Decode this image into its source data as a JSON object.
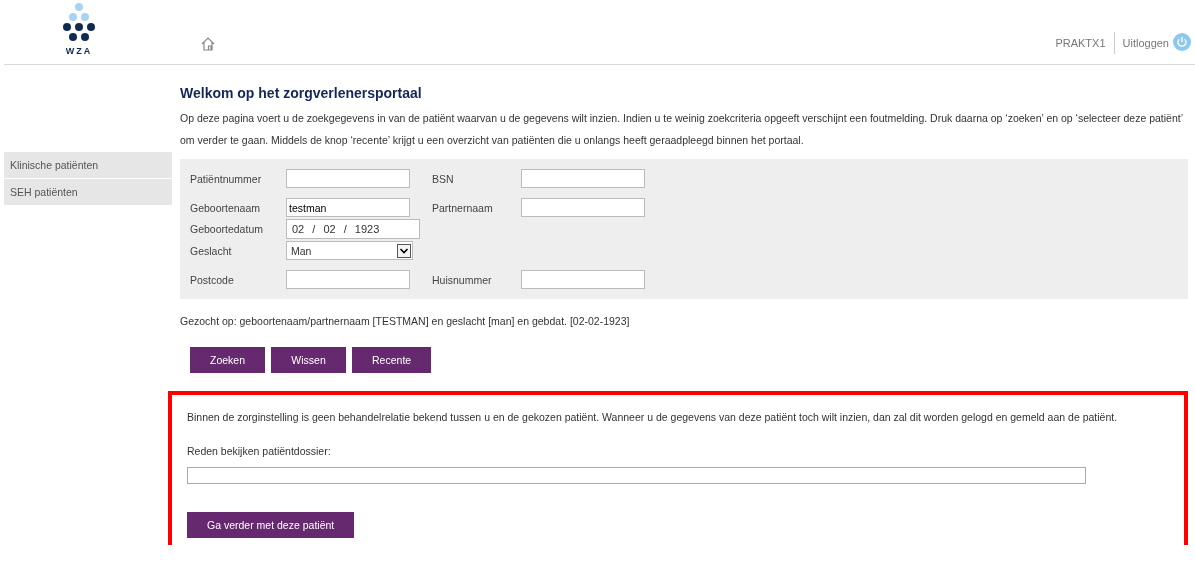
{
  "header": {
    "logo_text": "WZA",
    "user": "PRAKTX1",
    "logout": "Uitloggen"
  },
  "sidebar": {
    "items": [
      {
        "label": "Klinische patiënten",
        "selected": false
      },
      {
        "label": "SEH patiënten",
        "selected": false
      }
    ]
  },
  "title": "Welkom op het zorgverlenersportaal",
  "intro": "Op deze pagina voert u de zoekgegevens in van de patiënt waarvan u de gegevens wilt inzien. Indien u te weinig zoekcriteria opgeeft verschijnt een foutmelding. Druk daarna op ‘zoeken’ en op ‘selecteer deze patiënt’ om verder te gaan. Middels de knop ‘recente’ krijgt u een overzicht van patiënten die u onlangs heeft geraadpleegd binnen het portaal.",
  "form": {
    "groups": [
      {
        "rows": [
          {
            "fields": [
              {
                "label": "Patiëntnummer",
                "kind": "text"
              },
              {
                "label": "BSN",
                "kind": "text"
              }
            ]
          }
        ]
      },
      {
        "rows": [
          {
            "fields": [
              {
                "label": "Geboortenaam",
                "kind": "text",
                "value": "testman"
              },
              {
                "label": "Partnernaam",
                "kind": "text"
              }
            ]
          },
          {
            "fields": [
              {
                "label": "Geboortedatum",
                "kind": "date",
                "value": "02 / 02 / 1923"
              }
            ]
          },
          {
            "fields": [
              {
                "label": "Geslacht",
                "kind": "select",
                "value": "Man"
              }
            ]
          }
        ]
      },
      {
        "rows": [
          {
            "fields": [
              {
                "label": "Postcode",
                "kind": "text"
              },
              {
                "label": "Huisnummer",
                "kind": "text"
              }
            ]
          }
        ]
      }
    ]
  },
  "search_summary": "Gezocht op: geboortenaam/partnernaam [TESTMAN] en geslacht [man] en gebdat. [02-02-1923]",
  "buttons": [
    "Zoeken",
    "Wissen",
    "Recente"
  ],
  "consent": {
    "text": "Binnen de zorginstelling is geen behandelrelatie bekend tussen u en de gekozen patiënt. Wanneer u de gegevens van deze patiënt toch wilt inzien, dan zal dit worden gelogd en gemeld aan de patiënt.",
    "reason_label": "Reden bekijken patiëntdossier:",
    "button": "Ga verder met deze patiënt"
  }
}
